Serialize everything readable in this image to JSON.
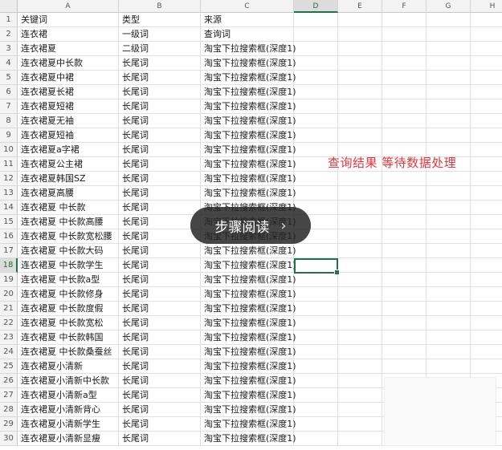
{
  "columns": [
    "A",
    "B",
    "C",
    "D",
    "E",
    "F",
    "G",
    "H"
  ],
  "active_column": "D",
  "active_row": 18,
  "rows": [
    {
      "n": "1",
      "a": "关键词",
      "b": "类型",
      "c": "来源"
    },
    {
      "n": "2",
      "a": "连衣裙",
      "b": "一级词",
      "c": "查询词"
    },
    {
      "n": "3",
      "a": "连衣裙夏",
      "b": "二级词",
      "c": "淘宝下拉搜索框(深度1)"
    },
    {
      "n": "4",
      "a": "连衣裙夏中长款",
      "b": "长尾词",
      "c": "淘宝下拉搜索框(深度1)"
    },
    {
      "n": "5",
      "a": "连衣裙夏中裙",
      "b": "长尾词",
      "c": "淘宝下拉搜索框(深度1)"
    },
    {
      "n": "6",
      "a": "连衣裙夏长裙",
      "b": "长尾词",
      "c": "淘宝下拉搜索框(深度1)"
    },
    {
      "n": "7",
      "a": "连衣裙夏短裙",
      "b": "长尾词",
      "c": "淘宝下拉搜索框(深度1)"
    },
    {
      "n": "8",
      "a": "连衣裙夏无袖",
      "b": "长尾词",
      "c": "淘宝下拉搜索框(深度1)"
    },
    {
      "n": "9",
      "a": "连衣裙夏短袖",
      "b": "长尾词",
      "c": "淘宝下拉搜索框(深度1)"
    },
    {
      "n": "10",
      "a": "连衣裙夏a字裙",
      "b": "长尾词",
      "c": "淘宝下拉搜索框(深度1)"
    },
    {
      "n": "11",
      "a": "连衣裙夏公主裙",
      "b": "长尾词",
      "c": "淘宝下拉搜索框(深度1)"
    },
    {
      "n": "12",
      "a": "连衣裙夏韩国SZ",
      "b": "长尾词",
      "c": "淘宝下拉搜索框(深度1)"
    },
    {
      "n": "13",
      "a": "连衣裙夏高腰",
      "b": "长尾词",
      "c": "淘宝下拉搜索框(深度1)"
    },
    {
      "n": "14",
      "a": "连衣裙夏 中长款",
      "b": "长尾词",
      "c": "淘宝下拉搜索框(深度1)"
    },
    {
      "n": "15",
      "a": "连衣裙夏 中长款高腰",
      "b": "长尾词",
      "c": "淘宝下拉搜索框(深度1)"
    },
    {
      "n": "16",
      "a": "连衣裙夏 中长款宽松腰",
      "b": "长尾词",
      "c": "淘宝下拉搜索框(深度1)"
    },
    {
      "n": "17",
      "a": "连衣裙夏 中长款大码",
      "b": "长尾词",
      "c": "淘宝下拉搜索框(深度1)"
    },
    {
      "n": "18",
      "a": "连衣裙夏 中长款学生",
      "b": "长尾词",
      "c": "淘宝下拉搜索框(深度1)"
    },
    {
      "n": "19",
      "a": "连衣裙夏 中长款a型",
      "b": "长尾词",
      "c": "淘宝下拉搜索框(深度1)"
    },
    {
      "n": "20",
      "a": "连衣裙夏 中长款修身",
      "b": "长尾词",
      "c": "淘宝下拉搜索框(深度1)"
    },
    {
      "n": "21",
      "a": "连衣裙夏 中长款度假",
      "b": "长尾词",
      "c": "淘宝下拉搜索框(深度1)"
    },
    {
      "n": "22",
      "a": "连衣裙夏 中长款宽松",
      "b": "长尾词",
      "c": "淘宝下拉搜索框(深度1)"
    },
    {
      "n": "23",
      "a": "连衣裙夏 中长款韩国",
      "b": "长尾词",
      "c": "淘宝下拉搜索框(深度1)"
    },
    {
      "n": "24",
      "a": "连衣裙夏 中长款桑蚕丝",
      "b": "长尾词",
      "c": "淘宝下拉搜索框(深度1)"
    },
    {
      "n": "25",
      "a": "连衣裙夏小清新",
      "b": "长尾词",
      "c": "淘宝下拉搜索框(深度1)"
    },
    {
      "n": "26",
      "a": "连衣裙夏小清新中长款",
      "b": "长尾词",
      "c": "淘宝下拉搜索框(深度1)"
    },
    {
      "n": "27",
      "a": "连衣裙夏小清新a型",
      "b": "长尾词",
      "c": "淘宝下拉搜索框(深度1)"
    },
    {
      "n": "28",
      "a": "连衣裙夏小清新背心",
      "b": "长尾词",
      "c": "淘宝下拉搜索框(深度1)"
    },
    {
      "n": "29",
      "a": "连衣裙夏小清新学生",
      "b": "长尾词",
      "c": "淘宝下拉搜索框(深度1)"
    },
    {
      "n": "30",
      "a": "连衣裙夏小清新显瘦",
      "b": "长尾词",
      "c": "淘宝下拉搜索框(深度1)"
    }
  ],
  "annotation": "查询结果 等待数据处理",
  "overlay": {
    "label": "步骤阅读",
    "icon": "chevron-right-icon",
    "chevron": "›"
  },
  "colors": {
    "annotation": "#e8343a",
    "selection": "#217346",
    "overlay_bg": "#222222"
  }
}
